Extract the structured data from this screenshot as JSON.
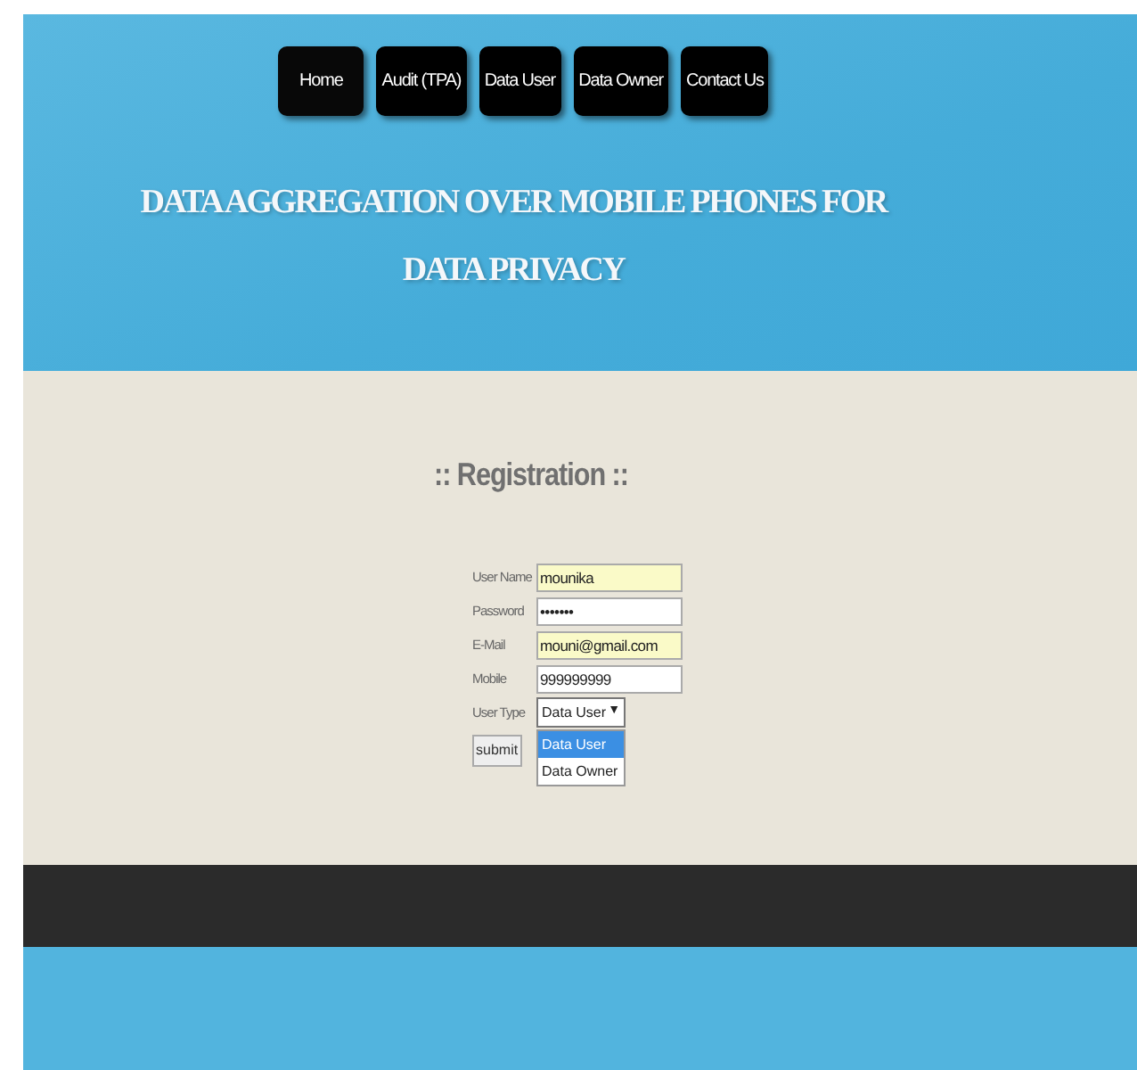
{
  "nav": [
    {
      "label": "Home",
      "selected": true
    },
    {
      "label": "Audit (TPA)",
      "selected": false
    },
    {
      "label": "Data User",
      "selected": false
    },
    {
      "label": "Data Owner",
      "selected": false
    },
    {
      "label": "Contact Us",
      "selected": false
    }
  ],
  "site_title": "DATA AGGREGATION OVER MOBILE PHONES FOR DATA PRIVACY",
  "form": {
    "heading": ":: Registration ::",
    "fields": [
      {
        "label": "User Name",
        "value": "mounika",
        "autofilled": true
      },
      {
        "label": "Password",
        "value": "•••••••",
        "autofilled": false
      },
      {
        "label": "E-Mail",
        "value": "mouni@gmail.com",
        "autofilled": true
      },
      {
        "label": "Mobile",
        "value": "999999999",
        "autofilled": false
      }
    ],
    "user_type": {
      "label": "User Type",
      "value": "Data User",
      "arrow": "▼",
      "options": [
        {
          "label": "Data User",
          "selected": true
        },
        {
          "label": "Data Owner",
          "selected": false
        }
      ]
    },
    "submit": "submit"
  }
}
